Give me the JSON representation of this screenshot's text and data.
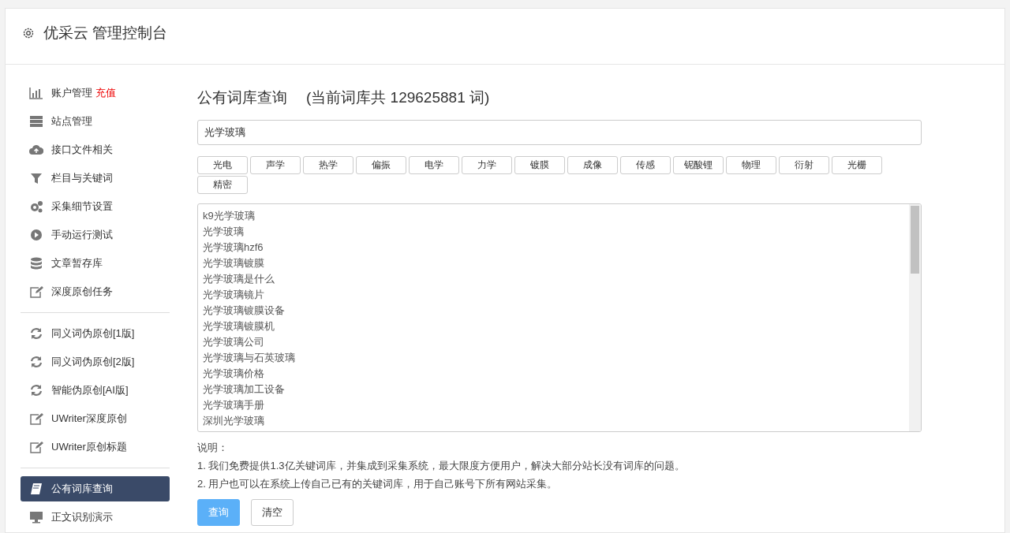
{
  "header": {
    "title": "优采云 管理控制台"
  },
  "sidebar": {
    "groups": [
      {
        "items": [
          {
            "label": "账户管理",
            "badge": "充值",
            "selected": false
          },
          {
            "label": "站点管理",
            "selected": false
          },
          {
            "label": "接口文件相关",
            "selected": false
          },
          {
            "label": "栏目与关键词",
            "selected": false
          },
          {
            "label": "采集细节设置",
            "selected": false
          },
          {
            "label": "手动运行测试",
            "selected": false
          },
          {
            "label": "文章暂存库",
            "selected": false
          },
          {
            "label": "深度原创任务",
            "selected": false
          }
        ]
      },
      {
        "items": [
          {
            "label": "同义词伪原创[1版]",
            "selected": false
          },
          {
            "label": "同义词伪原创[2版]",
            "selected": false
          },
          {
            "label": "智能伪原创[AI版]",
            "selected": false
          },
          {
            "label": "UWriter深度原创",
            "selected": false
          },
          {
            "label": "UWriter原创标题",
            "selected": false
          }
        ]
      },
      {
        "items": [
          {
            "label": "公有词库查询",
            "selected": true
          },
          {
            "label": "正文识别演示",
            "selected": false
          }
        ]
      }
    ]
  },
  "main": {
    "title": "公有词库查询",
    "subtitle": "(当前词库共 129625881 词)",
    "search": {
      "value": "光学玻璃"
    },
    "tags": [
      "光电",
      "声学",
      "热学",
      "偏振",
      "电学",
      "力学",
      "镀膜",
      "成像",
      "传感",
      "铌酸锂",
      "物理",
      "衍射",
      "光栅",
      "精密"
    ],
    "results": [
      "k9光学玻璃",
      "光学玻璃",
      "光学玻璃hzf6",
      "光学玻璃镀膜",
      "光学玻璃是什么",
      "光学玻璃镜片",
      "光学玻璃镀膜设备",
      "光学玻璃镀膜机",
      "光学玻璃公司",
      "光学玻璃与石英玻璃",
      "光学玻璃价格",
      "光学玻璃加工设备",
      "光学玻璃手册",
      "深圳光学玻璃"
    ],
    "notes_title": "说明：",
    "notes": [
      "1. 我们免费提供1.3亿关键词库，并集成到采集系统，最大限度方便用户，解决大部分站长没有词库的问题。",
      "2. 用户也可以在系统上传自己已有的关键词库，用于自己账号下所有网站采集。"
    ],
    "buttons": [
      {
        "label": "查询",
        "kind": "primary"
      },
      {
        "label": "清空",
        "kind": "default"
      }
    ]
  }
}
